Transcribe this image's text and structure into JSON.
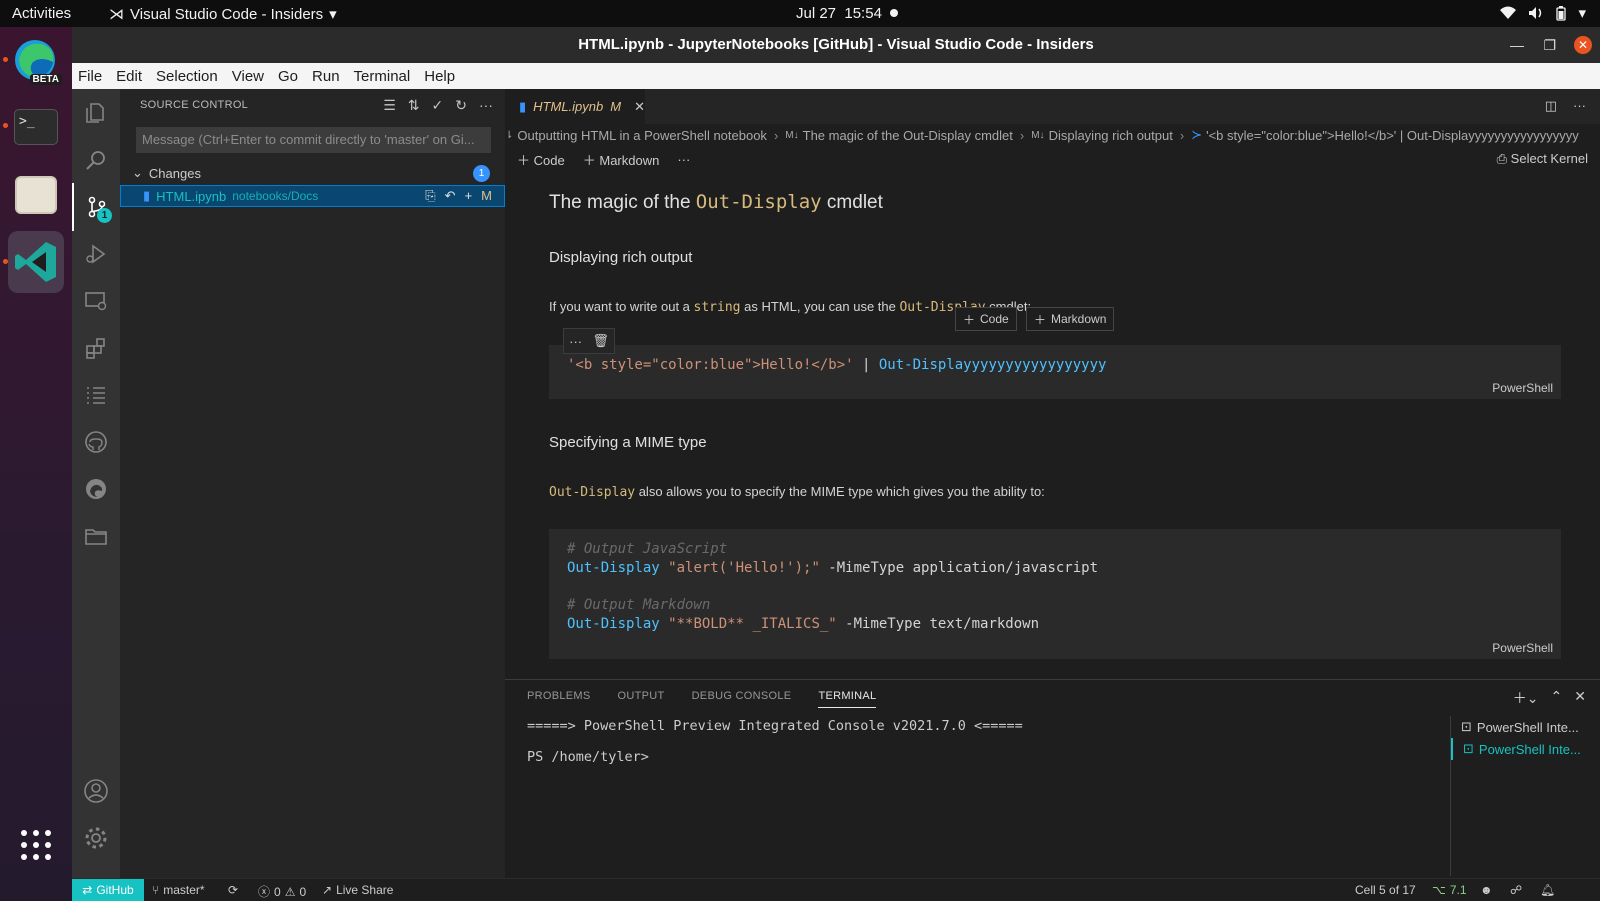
{
  "topbar": {
    "activities": "Activities",
    "app_name": "Visual Studio Code - Insiders",
    "date": "Jul 27",
    "time": "15:54"
  },
  "window": {
    "title": "HTML.ipynb - JupyterNotebooks [GitHub] - Visual Studio Code - Insiders"
  },
  "menu": [
    "File",
    "Edit",
    "Selection",
    "View",
    "Go",
    "Run",
    "Terminal",
    "Help"
  ],
  "dock": {
    "beta_label": "BETA"
  },
  "activity_bar": {
    "source_control_badge": "1"
  },
  "sidebar": {
    "header": "SOURCE CONTROL",
    "commit_placeholder": "Message (Ctrl+Enter to commit directly to 'master' on Gi...",
    "changes_label": "Changes",
    "changes_count": "1",
    "file_name": "HTML.ipynb",
    "file_path": "notebooks/Docs",
    "file_status": "M"
  },
  "editor": {
    "tab_label": "HTML.ipynb",
    "tab_status": "M",
    "breadcrumb": [
      "Outputting HTML in a PowerShell notebook",
      "The magic of the Out-Display cmdlet",
      "Displaying rich output",
      "'<b style=\"color:blue\">Hello!</b>' | Out-Displayyyyyyyyyyyyyyyyy"
    ],
    "toolbar": {
      "code": "Code",
      "markdown": "Markdown",
      "more": "···",
      "kernel": "Select Kernel"
    },
    "cells": {
      "h1_prefix": "The magic of the ",
      "h1_code": "Out-Display",
      "h1_suffix": " cmdlet",
      "h2_rich": "Displaying rich output",
      "p1_a": "If you want to write out a ",
      "p1_code1": "string",
      "p1_b": " as HTML, you can use the ",
      "p1_code2": "Out-Display",
      "p1_c": " cmdlet:",
      "insert_code": "Code",
      "insert_markdown": "Markdown",
      "code1_str": "'<b style=\"color:blue\">Hello!</b>'",
      "code1_pipe": " | ",
      "code1_cmd": "Out-Displayyyyyyyyyyyyyyyyy",
      "lang": "PowerShell",
      "h2_mime": "Specifying a MIME type",
      "p2_code": "Out-Display",
      "p2_text": " also allows you to specify the MIME type which gives you the ability to:",
      "code2_c1": "# Output JavaScript",
      "code2_l1_cmd": "Out-Display",
      "code2_l1_str": "\"alert('Hello!');\"",
      "code2_l1_rest": " -MimeType application/javascript",
      "code2_c2": "# Output Markdown",
      "code2_l2_cmd": "Out-Display",
      "code2_l2_str": "\"**BOLD** _ITALICS_\"",
      "code2_l2_rest": " -MimeType text/markdown"
    }
  },
  "panel": {
    "tabs": [
      "PROBLEMS",
      "OUTPUT",
      "DEBUG CONSOLE",
      "TERMINAL"
    ],
    "terminal_line1": "=====> PowerShell Preview Integrated Console v2021.7.0 <=====",
    "terminal_line2": "PS /home/tyler>",
    "terminals": [
      "PowerShell Inte...",
      "PowerShell Inte..."
    ]
  },
  "statusbar": {
    "remote": "GitHub",
    "branch": "master*",
    "errors": "0",
    "warnings": "0",
    "live_share": "Live Share",
    "cell_pos": "Cell 5 of 17",
    "ps_version": "7.1"
  },
  "colors": {
    "accent": "#16c2c2",
    "ubuntu_orange": "#e95420"
  }
}
